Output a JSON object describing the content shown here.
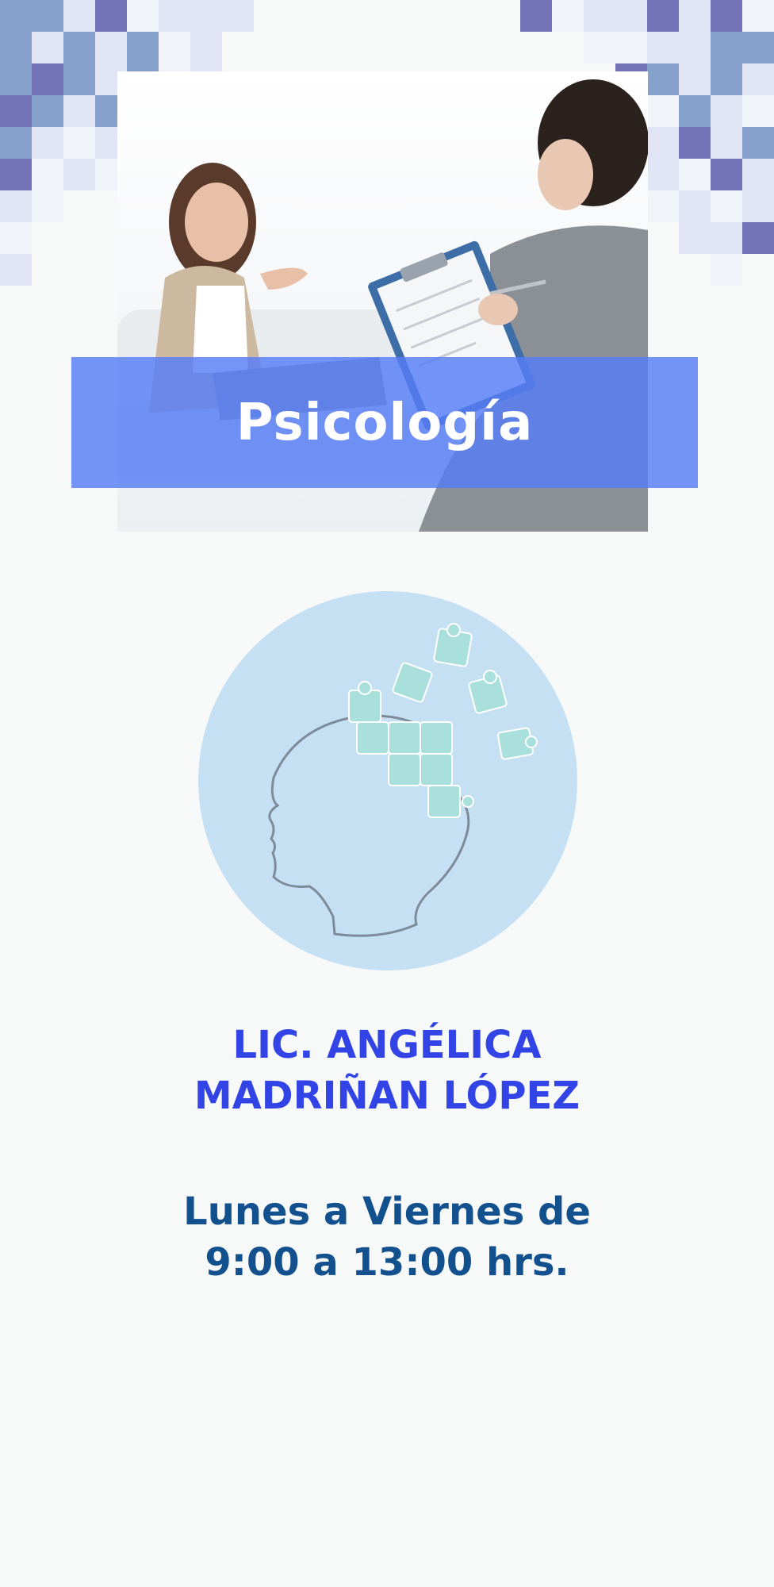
{
  "banner": {
    "title": "Psicología"
  },
  "doctor": {
    "name_line1": "LIC. ANGÉLICA",
    "name_line2": "MADRIÑAN LÓPEZ"
  },
  "schedule": {
    "line1": "Lunes a Viernes de",
    "line2": "9:00 a 13:00 hrs."
  },
  "colors": {
    "banner": "#567df6",
    "name": "#3244e6",
    "schedule": "#12508e",
    "circle": "#c6e0f3",
    "puzzle": "#a9e0dc",
    "pixel_dark": "#6e6bb4",
    "pixel_mid": "#7f9dc9",
    "pixel_light": "#dfe3f3"
  },
  "icons": [
    "pixel-mosaic-decoration",
    "therapy-session-photo",
    "head-puzzle-icon"
  ]
}
